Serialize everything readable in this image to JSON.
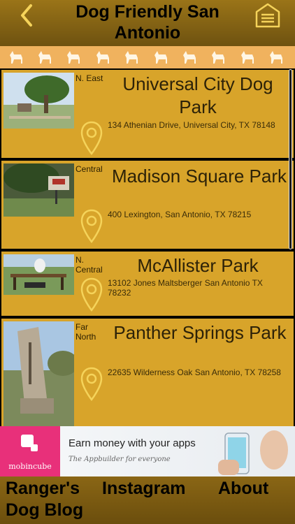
{
  "header": {
    "title": "Dog Friendly San Antonio"
  },
  "icons": {
    "back": "chevron-left-icon",
    "menu": "home-menu-icon",
    "paw": "dog-icon",
    "location": "location-pin-icon"
  },
  "colors": {
    "header_gold": "#9a7418",
    "card_gold": "#d8a42a",
    "icon_yellow": "#f5d35a",
    "strip_orange": "#f0b25e",
    "ad_pink": "#e8307a"
  },
  "parks": [
    {
      "region": "N. East",
      "name": "Universal City Dog Park",
      "address": "134 Athenian Drive, Universal City, TX 78148"
    },
    {
      "region": "Central",
      "name": "Madison Square Park",
      "address": "400 Lexington, San Antonio, TX 78215"
    },
    {
      "region": "N. Central",
      "name": "McAllister Park",
      "address": "13102 Jones Maltsberger San Antonio TX 78232"
    },
    {
      "region": "Far North",
      "name": "Panther Springs Park",
      "address": "22635 Wilderness Oak San Antonio, TX 78258"
    }
  ],
  "ad": {
    "brand": "mobincube",
    "headline": "Earn money with your apps",
    "subline": "The Appbuilder for everyone"
  },
  "footer": {
    "blog": "Ranger's Dog Blog",
    "instagram": "Instagram",
    "about": "About"
  }
}
